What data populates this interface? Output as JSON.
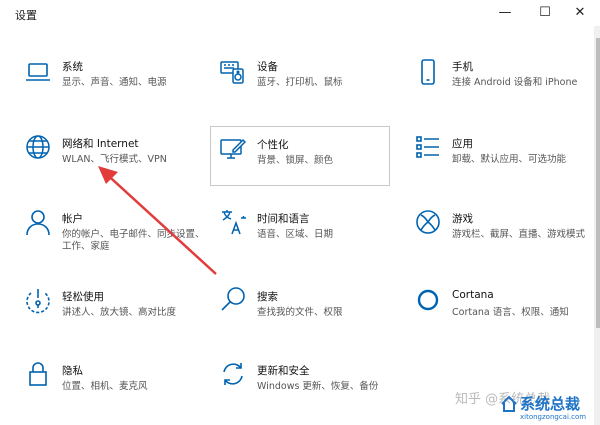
{
  "window": {
    "title": "设置",
    "minimize": "—",
    "maximize": "☐",
    "close": "✕"
  },
  "tiles": [
    {
      "title": "系统",
      "desc": "显示、声音、通知、电源",
      "icon": "laptop-icon"
    },
    {
      "title": "设备",
      "desc": "蓝牙、打印机、鼠标",
      "icon": "devices-icon"
    },
    {
      "title": "手机",
      "desc": "连接 Android 设备和 iPhone",
      "icon": "phone-icon"
    },
    {
      "title": "网络和 Internet",
      "desc": "WLAN、飞行模式、VPN",
      "icon": "globe-icon"
    },
    {
      "title": "个性化",
      "desc": "背景、锁屏、颜色",
      "icon": "personalization-icon"
    },
    {
      "title": "应用",
      "desc": "卸载、默认应用、可选功能",
      "icon": "apps-list-icon"
    },
    {
      "title": "帐户",
      "desc_lines": [
        "你的帐户、电子邮件、同步设置、",
        "工作、家庭"
      ],
      "icon": "person-icon"
    },
    {
      "title": "时间和语言",
      "desc": "语音、区域、日期",
      "icon": "time-language-icon"
    },
    {
      "title": "游戏",
      "desc": "游戏栏、截屏、直播、游戏模式",
      "icon": "xbox-icon"
    },
    {
      "title": "轻松使用",
      "desc": "讲述人、放大镜、高对比度",
      "icon": "ease-of-access-icon"
    },
    {
      "title": "搜索",
      "desc": "查找我的文件、权限",
      "icon": "search-icon"
    },
    {
      "title": "Cortana",
      "desc": "Cortana 语言、权限、通知",
      "icon": "cortana-icon"
    },
    {
      "title": "隐私",
      "desc": "位置、相机、麦克风",
      "icon": "lock-icon"
    },
    {
      "title": "更新和安全",
      "desc": "Windows 更新、恢复、备份",
      "icon": "update-icon"
    }
  ],
  "watermark": {
    "text": "知乎 @系统总裁",
    "logo": "系统总裁",
    "url": "xitongzongcai.com"
  },
  "colors": {
    "accent": "#0063b1",
    "arrow": "#e23b3b",
    "watermark_blue": "#1e73c8"
  }
}
